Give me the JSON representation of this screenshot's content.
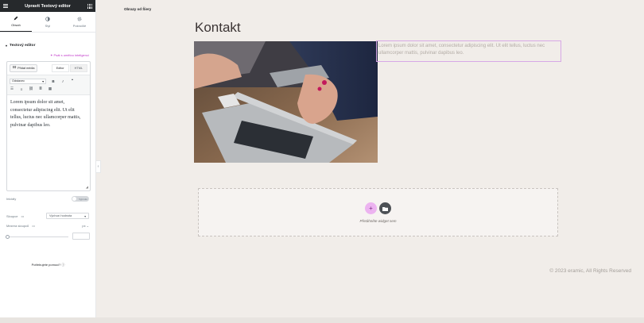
{
  "panel": {
    "title": "Upravit Textový editor",
    "tabs": [
      {
        "label": "Obsah",
        "icon": "pencil-icon",
        "active": true
      },
      {
        "label": "Styl",
        "icon": "contrast-icon",
        "active": false
      },
      {
        "label": "Pokročilé",
        "icon": "gear-icon",
        "active": false
      }
    ],
    "section_title": "Textový editor",
    "ai_link": "✦ Psát s umělou inteligencí",
    "editor": {
      "add_media": "Přidat média",
      "mode_visual": "Editor",
      "mode_html": "HTML",
      "format_select": "Odstavec",
      "content": "Lorem ipsum dolor sit amet, consectetur adipiscing elit. Ut elit tellus, luctus nec ullamcorper mattis, pulvinar dapibus leo."
    },
    "dropcap_label": "Iniciály",
    "dropcap_value": "Vypnuto",
    "columns_label": "Sloupce",
    "columns_value": "Výchozí hodnota",
    "gap_label": "Mezera sloupců",
    "gap_unit": "px",
    "help_text": "Potřebujete pomoci?"
  },
  "preview": {
    "site_title": "Obrazy od Šiery",
    "heading": "Kontakt",
    "text": "Lorem ipsum dolor sit amet, consectetur adipiscing elit. Ut elit tellus, luctus nec ullamcorper mattis, pulvinar dapibus leo.",
    "dropzone_text": "Přetáhněte widget sem",
    "copyright": "© 2023 eramic, All Rights Reserved"
  },
  "colors": {
    "accent": "#c036c9",
    "panel_header": "#26292c",
    "canvas_bg": "#f1ede9"
  }
}
